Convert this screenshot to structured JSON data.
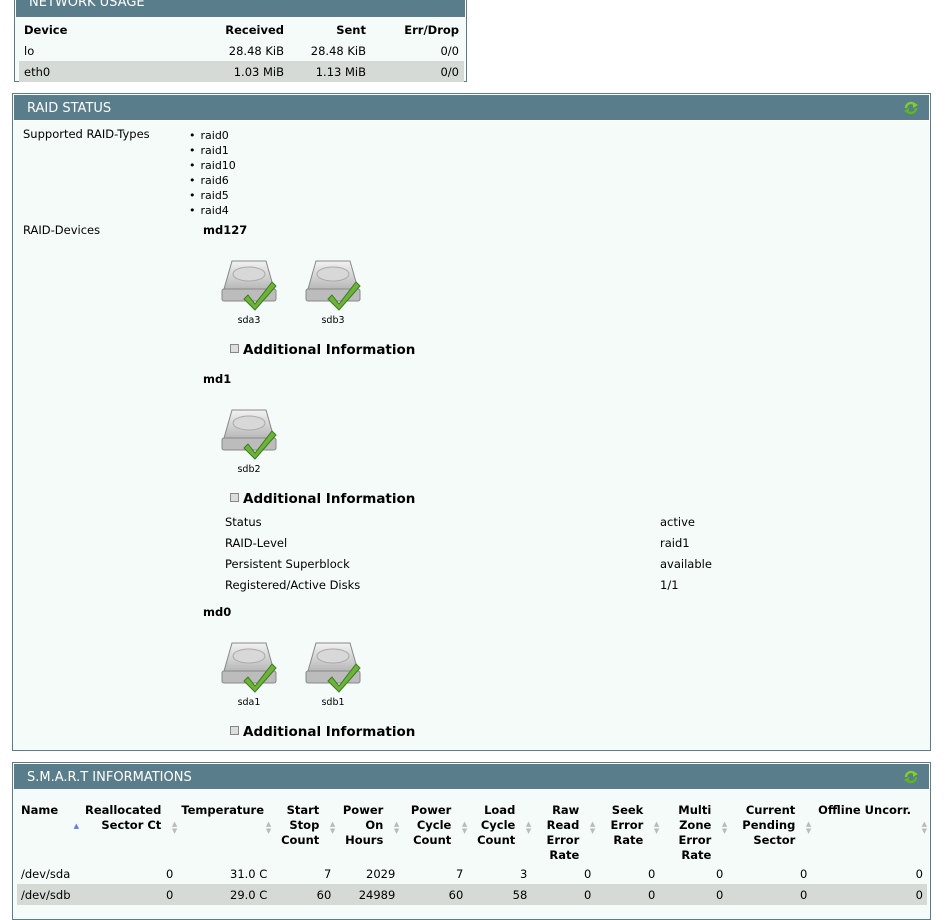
{
  "network": {
    "title": "NETWORK USAGE",
    "headers": [
      "Device",
      "Received",
      "Sent",
      "Err/Drop"
    ],
    "rows": [
      [
        "lo",
        "28.48 KiB",
        "28.48 KiB",
        "0/0"
      ],
      [
        "eth0",
        "1.03 MiB",
        "1.13 MiB",
        "0/0"
      ]
    ]
  },
  "raid": {
    "title": "RAID STATUS",
    "supported_label": "Supported RAID-Types",
    "types": [
      "raid0",
      "raid1",
      "raid10",
      "raid6",
      "raid5",
      "raid4"
    ],
    "devices_label": "RAID-Devices",
    "additional_info_label": "Additional Information",
    "devices": [
      {
        "name": "md127",
        "disks": [
          "sda3",
          "sdb3"
        ]
      },
      {
        "name": "md1",
        "disks": [
          "sdb2"
        ],
        "info": [
          [
            "Status",
            "active"
          ],
          [
            "RAID-Level",
            "raid1"
          ],
          [
            "Persistent Superblock",
            "available"
          ],
          [
            "Registered/Active Disks",
            "1/1"
          ]
        ]
      },
      {
        "name": "md0",
        "disks": [
          "sda1",
          "sdb1"
        ]
      }
    ]
  },
  "smart": {
    "title": "S.M.A.R.T INFORMATIONS",
    "headers": [
      "Name",
      "Reallocated Sector Ct",
      "Temperature",
      "Start Stop Count",
      "Power On Hours",
      "Power Cycle Count",
      "Load Cycle Count",
      "Raw Read Error Rate",
      "Seek Error Rate",
      "Multi Zone Error Rate",
      "Current Pending Sector",
      "Offline Uncorr."
    ],
    "rows": [
      [
        "/dev/sda",
        "0",
        "31.0 C",
        "7",
        "2029",
        "7",
        "3",
        "0",
        "0",
        "0",
        "0",
        "0"
      ],
      [
        "/dev/sdb",
        "0",
        "29.0 C",
        "60",
        "24989",
        "60",
        "58",
        "0",
        "0",
        "0",
        "0",
        "0"
      ]
    ]
  },
  "colors": {
    "header": "#5a7d8c",
    "panel_bg": "#f4fbf8",
    "row_highlight": "#d5dad7",
    "check": "#6bb33a"
  }
}
